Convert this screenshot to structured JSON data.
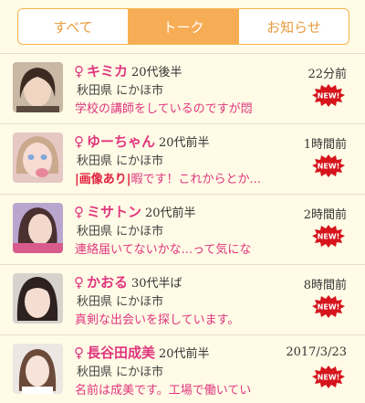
{
  "tabs": [
    {
      "label": "すべて",
      "active": false
    },
    {
      "label": "トーク",
      "active": true
    },
    {
      "label": "お知らせ",
      "active": false
    }
  ],
  "gender_symbol": "♀",
  "new_badge": "NEW!",
  "colors": {
    "accent": "#f7ad55",
    "pink": "#e0357e",
    "badge_red": "#d6141c",
    "background": "#fffbe6"
  },
  "conversations": [
    {
      "name": "キミカ",
      "age": "20代後半",
      "location": "秋田県 にかほ市",
      "tag": "",
      "message": "学校の講師をしているのですが悶",
      "time": "22分前",
      "avatar_icon": "profile-photo-woman"
    },
    {
      "name": "ゆーちゃん",
      "age": "20代前半",
      "location": "秋田県 にかほ市",
      "tag": "|画像あり|",
      "message": "暇です！これからとか...",
      "time": "1時間前",
      "avatar_icon": "profile-photo-woman"
    },
    {
      "name": "ミサトン",
      "age": "20代前半",
      "location": "秋田県 にかほ市",
      "tag": "",
      "message": "連絡届いてないかな...って気にな",
      "time": "2時間前",
      "avatar_icon": "profile-photo-woman"
    },
    {
      "name": "かおる",
      "age": "30代半ば",
      "location": "秋田県 にかほ市",
      "tag": "",
      "message": "真剣な出会いを探しています。",
      "time": "8時間前",
      "avatar_icon": "profile-photo-woman"
    },
    {
      "name": "長谷田成美",
      "age": "20代前半",
      "location": "秋田県 にかほ市",
      "tag": "",
      "message": "名前は成美です。工場で働いてい",
      "time": "2017/3/23",
      "avatar_icon": "profile-photo-woman"
    }
  ]
}
